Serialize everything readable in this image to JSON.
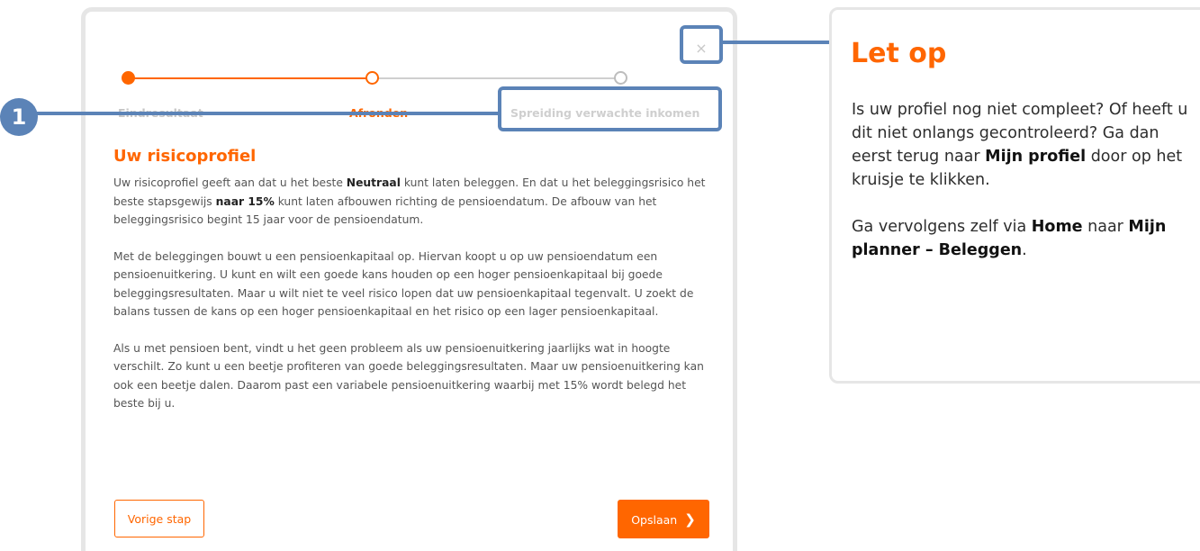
{
  "modal": {
    "close_symbol": "×",
    "steps": [
      {
        "label": "Eindresultaat",
        "state": "done"
      },
      {
        "label": "Afronden",
        "state": "current"
      },
      {
        "label": "Spreiding verwachte inkomen",
        "state": "upcoming"
      }
    ],
    "title": "Uw risicoprofiel",
    "p1": {
      "a": "Uw risicoprofiel geeft aan dat u het beste ",
      "b": "Neutraal",
      "c": " kunt laten beleggen. En dat u het beleggingsrisico het beste stapsgewijs ",
      "d": "naar 15%",
      "e": " kunt laten afbouwen richting de pensioendatum. De afbouw van het beleggingsrisico begint 15 jaar voor de pensioendatum."
    },
    "p2": "Met de beleggingen bouwt u een pensioenkapitaal op. Hiervan koopt u op uw pensioendatum een pensioenuitkering. U kunt en wilt een goede kans houden op een hoger pensioenkapitaal bij goede beleggingsresultaten. Maar u wilt niet te veel risico lopen dat uw pensioenkapitaal tegenvalt. U zoekt de balans tussen de kans op een hoger pensioenkapitaal en het risico op een lager pensioenkapitaal.",
    "p3": "Als u met pensioen bent, vindt u het geen probleem als uw pensioenuitkering jaarlijks wat in hoogte verschilt. Zo kunt u een beetje profiteren van goede beleggingsresultaten. Maar uw pensioenuitkering kan ook een beetje dalen. Daarom past een variabele pensioenuitkering waarbij met 15% wordt belegd het beste bij u.",
    "prev_button": "Vorige stap",
    "save_button": "Opslaan",
    "save_chevron": "❯"
  },
  "annotation": {
    "badge_number": "1",
    "color": "#5b83b7"
  },
  "callout": {
    "title": "Let op",
    "p1": {
      "a": "Is uw profiel nog niet compleet? Of heeft u dit niet onlangs gecontroleerd? Ga dan eerst terug naar ",
      "b": "Mijn profiel",
      "c": " door op het kruisje te klikken."
    },
    "p2": {
      "a": "Ga vervolgens zelf via ",
      "b": "Home",
      "c": " naar ",
      "d": "Mijn planner – Beleggen",
      "e": "."
    }
  },
  "colors": {
    "accent": "#ff6600",
    "annotation": "#5b83b7",
    "border": "#e6e6e6"
  }
}
